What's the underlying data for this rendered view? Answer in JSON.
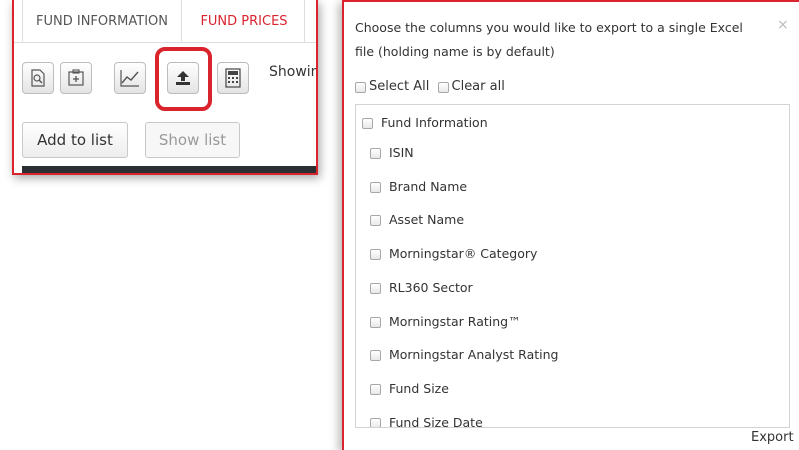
{
  "tabs": {
    "fund_information": "FUND INFORMATION",
    "fund_prices": "FUND PRICES"
  },
  "toolbar": {
    "icons": [
      "document-search-icon",
      "add-document-icon",
      "chart-icon",
      "export-upload-icon",
      "calculator-icon"
    ],
    "showing_text": "Showin"
  },
  "actions": {
    "add_to_list": "Add to list",
    "show_list": "Show list"
  },
  "modal": {
    "description": "Choose the columns you would like to export to a single Excel file (holding name is by default)",
    "close": "×",
    "select_all": "Select All",
    "clear_all": "Clear all",
    "group_label": "Fund Information",
    "options": [
      "ISIN",
      "Brand Name",
      "Asset Name",
      "Morningstar® Category",
      "RL360 Sector",
      "Morningstar Rating™",
      "Morningstar Analyst Rating",
      "Fund Size",
      "Fund Size Date"
    ],
    "export_label": "Export"
  },
  "colors": {
    "accent_red": "#d9232d",
    "dark_bar": "#2b2f33"
  }
}
